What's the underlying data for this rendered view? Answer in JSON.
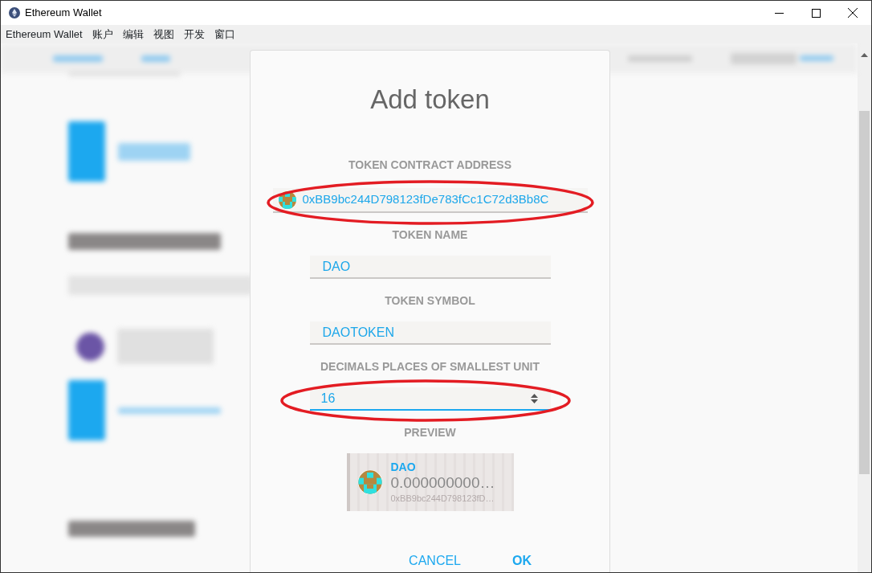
{
  "window": {
    "title": "Ethereum Wallet"
  },
  "menu": [
    "Ethereum Wallet",
    "账户",
    "编辑",
    "视图",
    "开发",
    "窗口"
  ],
  "dialog": {
    "title": "Add token",
    "fields": [
      {
        "kind": "address",
        "label": "TOKEN CONTRACT ADDRESS",
        "value": "0xBB9bc244D798123fDe783fCc1C72d3Bb8C",
        "focused": false,
        "circled": true
      },
      {
        "kind": "text",
        "label": "TOKEN NAME",
        "value": "DAO",
        "focused": false,
        "circled": false
      },
      {
        "kind": "text",
        "label": "TOKEN SYMBOL",
        "value": "DAOTOKEN",
        "focused": false,
        "circled": false
      },
      {
        "kind": "number",
        "label": "DECIMALS PLACES OF SMALLEST UNIT",
        "value": "16",
        "focused": true,
        "circled": true
      }
    ],
    "preview": {
      "label": "PREVIEW",
      "name": "DAO",
      "balance": "0.000000000…",
      "address": "0xBB9bc244D798123fD…"
    },
    "buttons": [
      {
        "kind": "cancel",
        "label": "CANCEL"
      },
      {
        "kind": "ok",
        "label": "OK"
      }
    ]
  }
}
